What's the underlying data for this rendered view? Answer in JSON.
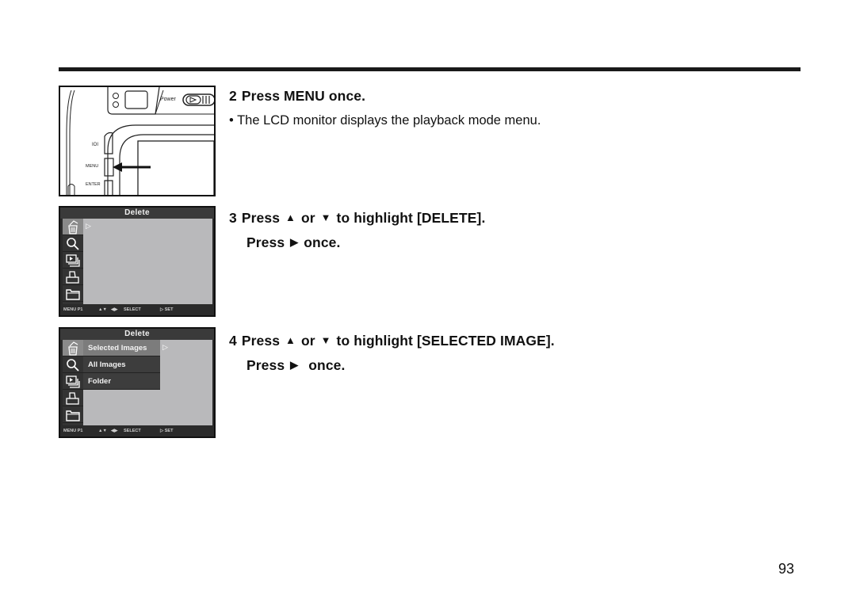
{
  "page": {
    "number": "93"
  },
  "figures": {
    "camera": {
      "labels": {
        "power": "Power",
        "display_button": "IOI",
        "menu_button": "MENU",
        "enter_button": "ENTER"
      }
    },
    "lcd1": {
      "title": "Delete",
      "cursor": "▷",
      "icons": [
        "delete-icon",
        "magnify-icon",
        "slideshow-icon",
        "print-icon",
        "folder-icon"
      ],
      "active_icon_index": 0,
      "status": {
        "menu": "MENU P1",
        "updown": "▲▼",
        "leftright": "◀▶",
        "select": "SELECT",
        "set": "▷ SET"
      }
    },
    "lcd2": {
      "title": "Delete",
      "icons": [
        "delete-icon",
        "magnify-icon",
        "slideshow-icon",
        "print-icon",
        "folder-icon"
      ],
      "active_icon_index": 0,
      "submenu": [
        {
          "label": "Selected Images",
          "selected": true
        },
        {
          "label": "All Images",
          "selected": false
        },
        {
          "label": "Folder",
          "selected": false
        }
      ],
      "cursor": "▷",
      "status": {
        "menu": "MENU P1",
        "updown": "▲▼",
        "leftright": "◀▶",
        "select": "SELECT",
        "set": "▷ SET"
      }
    }
  },
  "steps": [
    {
      "number": "2",
      "line1": "Press MENU once.",
      "bullet": "• The LCD monitor displays the playback mode menu."
    },
    {
      "number": "3",
      "press": "Press",
      "up": "▲",
      "or": "or",
      "down": "▼",
      "highlight": "to highlight [DELETE].",
      "press2": "Press",
      "right": "▶",
      "once": "once."
    },
    {
      "number": "4",
      "press": "Press",
      "up": "▲",
      "or": "or",
      "down": "▼",
      "highlight": "to highlight [SELECTED IMAGE].",
      "press2": "Press",
      "right": "▶",
      "once": "once."
    }
  ]
}
